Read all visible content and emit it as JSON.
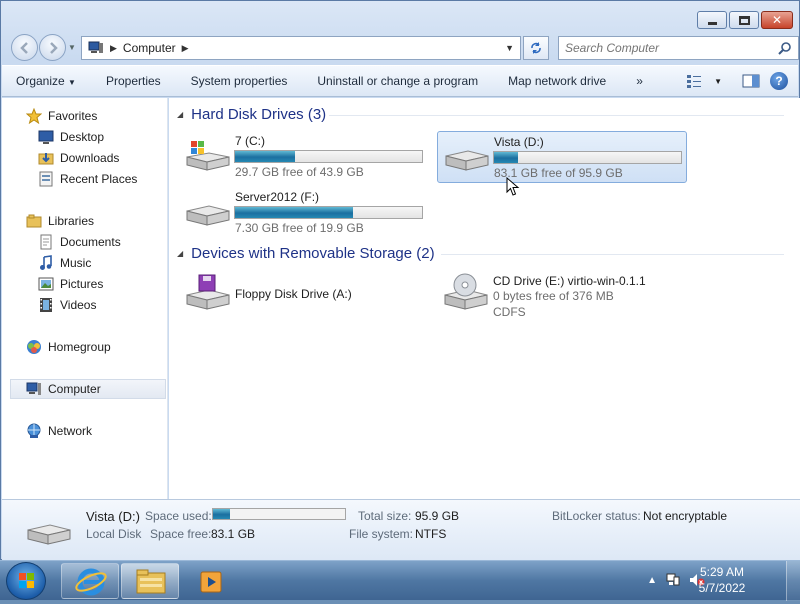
{
  "window": {
    "caption_buttons": [
      "minimize-icon",
      "maximize-icon",
      "close-icon"
    ]
  },
  "nav": {
    "address_root": "Computer",
    "search_placeholder": "Search Computer"
  },
  "toolbar": {
    "organize": "Organize",
    "properties": "Properties",
    "system_properties": "System properties",
    "uninstall": "Uninstall or change a program",
    "map_drive": "Map network drive",
    "more": "»"
  },
  "sidebar": {
    "favorites": "Favorites",
    "desktop": "Desktop",
    "downloads": "Downloads",
    "recent": "Recent Places",
    "libraries": "Libraries",
    "documents": "Documents",
    "music": "Music",
    "pictures": "Pictures",
    "videos": "Videos",
    "homegroup": "Homegroup",
    "computer": "Computer",
    "network": "Network"
  },
  "groups": {
    "hdd": "Hard Disk Drives (3)",
    "removable": "Devices with Removable Storage (2)"
  },
  "drives": [
    {
      "name": "7 (C:)",
      "free": "29.7 GB free of 43.9 GB",
      "used_fraction": 0.32
    },
    {
      "name": "Vista (D:)",
      "free": "83.1 GB free of 95.9 GB",
      "used_fraction": 0.13
    },
    {
      "name": "Server2012 (F:)",
      "free": "7.30 GB free of 19.9 GB",
      "used_fraction": 0.63
    }
  ],
  "removable": [
    {
      "name": "Floppy Disk Drive (A:)"
    },
    {
      "name": "CD Drive (E:) virtio-win-0.1.1",
      "line2": "0 bytes free of 376 MB",
      "line3": "CDFS"
    }
  ],
  "details": {
    "name": "Vista (D:)",
    "type": "Local Disk",
    "space_used_label": "Space used:",
    "space_free_label": "Space free:",
    "space_free": "83.1 GB",
    "used_fraction": 0.13,
    "total_size_label": "Total size:",
    "total_size": "95.9 GB",
    "fs_label": "File system:",
    "fs": "NTFS",
    "bitlocker_label": "BitLocker status:",
    "bitlocker": "Not encryptable"
  },
  "taskbar": {
    "time": "5:29 AM",
    "date": "5/7/2022"
  }
}
